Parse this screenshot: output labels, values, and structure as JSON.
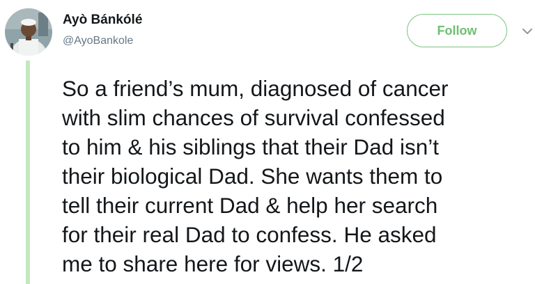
{
  "tweet": {
    "author": {
      "display_name": "Ayò Bánkólé",
      "handle": "@AyoBankole"
    },
    "follow_label": "Follow",
    "text_lines": [
      "So a friend’s mum, diagnosed of cancer",
      "with slim chances of survival confessed",
      "to him & his siblings that their Dad isn’t",
      "their biological Dad. She wants them to",
      "tell their current Dad & help her search",
      "for their real Dad to confess. He asked",
      "me to share here for views. 1/2"
    ]
  },
  "icons": {
    "menu": "chevron-down-icon",
    "avatar": "profile-photo"
  },
  "colors": {
    "accent": "#6fbf73",
    "thread_line": "#c4e8bd",
    "text": "#14171a",
    "secondary_text": "#657786"
  }
}
